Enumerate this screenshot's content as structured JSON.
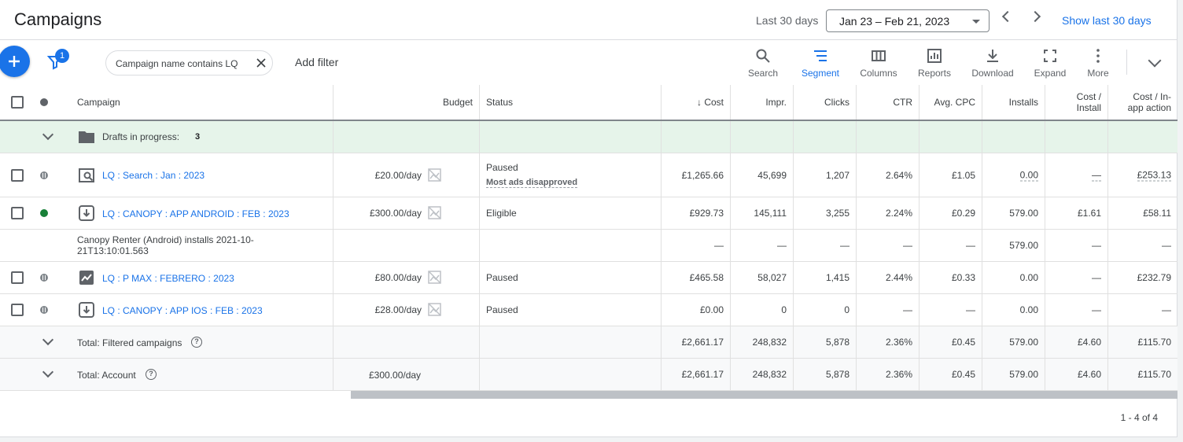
{
  "header": {
    "title": "Campaigns",
    "range_label": "Last 30 days",
    "date_range": "Jan 23 – Feb 21, 2023",
    "show_last": "Show last 30 days"
  },
  "toolbar": {
    "filter_count": "1",
    "filter_chip": "Campaign name contains LQ",
    "add_filter": "Add filter",
    "tools": [
      "Search",
      "Segment",
      "Columns",
      "Reports",
      "Download",
      "Expand",
      "More"
    ],
    "active_tool": "Segment"
  },
  "columns": {
    "campaign": "Campaign",
    "budget": "Budget",
    "status": "Status",
    "cost": "Cost",
    "impr": "Impr.",
    "clicks": "Clicks",
    "ctr": "CTR",
    "avg_cpc": "Avg. CPC",
    "installs": "Installs",
    "cost_install_1": "Cost /",
    "cost_install_2": "Install",
    "cost_inapp_1": "Cost / In-",
    "cost_inapp_2": "app action"
  },
  "drafts": {
    "label": "Drafts in progress:",
    "count": "3"
  },
  "rows": [
    {
      "name": "LQ : Search : Jan : 2023",
      "budget": "£20.00/day",
      "status": "Paused",
      "status_sub": "Most ads disapproved",
      "cost": "£1,265.66",
      "impr": "45,699",
      "clicks": "1,207",
      "ctr": "2.64%",
      "cpc": "£1.05",
      "installs": "0.00",
      "cost_install": "—",
      "cost_inapp": "£253.13",
      "dot": "paused",
      "icon": "search-campaign-icon"
    },
    {
      "name": "LQ : CANOPY : APP ANDROID : FEB : 2023",
      "budget": "£300.00/day",
      "status": "Eligible",
      "status_sub": "",
      "cost": "£929.73",
      "impr": "145,111",
      "clicks": "3,255",
      "ctr": "2.24%",
      "cpc": "£0.29",
      "installs": "579.00",
      "cost_install": "£1.61",
      "cost_inapp": "£58.11",
      "dot": "green",
      "icon": "app-campaign-icon"
    },
    {
      "name": "LQ : P MAX : FEBRERO : 2023",
      "budget": "£80.00/day",
      "status": "Paused",
      "status_sub": "",
      "cost": "£465.58",
      "impr": "58,027",
      "clicks": "1,415",
      "ctr": "2.44%",
      "cpc": "£0.33",
      "installs": "0.00",
      "cost_install": "—",
      "cost_inapp": "£232.79",
      "dot": "paused",
      "icon": "pmax-campaign-icon"
    },
    {
      "name": "LQ : CANOPY : APP IOS : FEB : 2023",
      "budget": "£28.00/day",
      "status": "Paused",
      "status_sub": "",
      "cost": "£0.00",
      "impr": "0",
      "clicks": "0",
      "ctr": "—",
      "cpc": "—",
      "installs": "0.00",
      "cost_install": "—",
      "cost_inapp": "—",
      "dot": "paused",
      "icon": "app-campaign-icon"
    }
  ],
  "conversion_row": {
    "label_1": "Canopy Renter (Android) installs 2021-10-",
    "label_2": "21T13:10:01.563",
    "cost": "—",
    "impr": "—",
    "clicks": "—",
    "ctr": "—",
    "cpc": "—",
    "installs": "579.00",
    "cost_install": "—",
    "cost_inapp": "—"
  },
  "totals": [
    {
      "label": "Total: Filtered campaigns",
      "budget": "",
      "cost": "£2,661.17",
      "impr": "248,832",
      "clicks": "5,878",
      "ctr": "2.36%",
      "cpc": "£0.45",
      "installs": "579.00",
      "cost_install": "£4.60",
      "cost_inapp": "£115.70"
    },
    {
      "label": "Total: Account",
      "budget": "£300.00/day",
      "cost": "£2,661.17",
      "impr": "248,832",
      "clicks": "5,878",
      "ctr": "2.36%",
      "cpc": "£0.45",
      "installs": "579.00",
      "cost_install": "£4.60",
      "cost_inapp": "£115.70"
    }
  ],
  "pagination": "1 - 4 of 4",
  "colors": {
    "accent": "#1a73e8",
    "eligible": "#188038",
    "drafts_bg": "#e6f4ea"
  }
}
